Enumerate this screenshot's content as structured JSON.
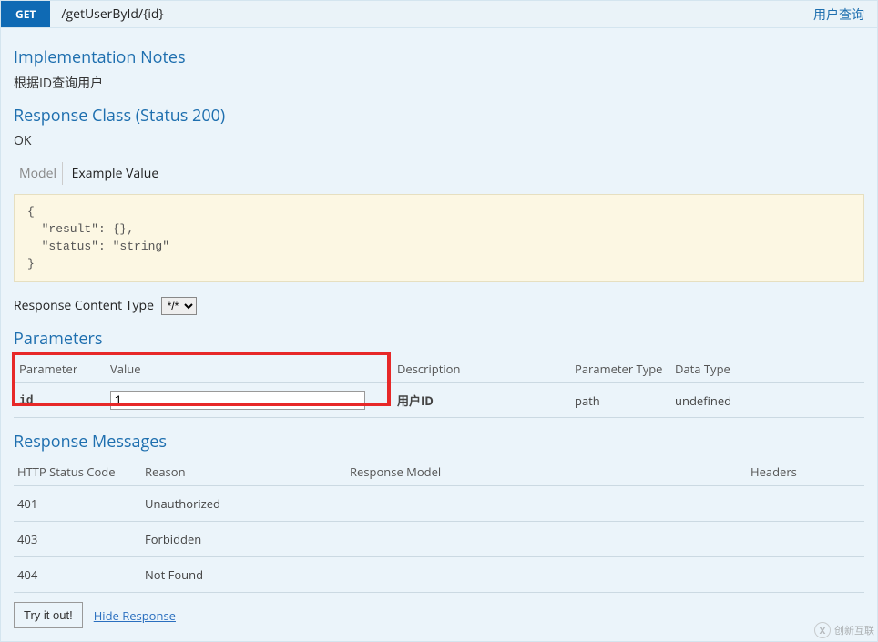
{
  "header": {
    "method": "GET",
    "path": "/getUserById/{id}",
    "summary": "用户查询"
  },
  "notes": {
    "heading": "Implementation Notes",
    "text": "根据ID查询用户"
  },
  "response_class": {
    "heading": "Response Class (Status 200)",
    "status_text": "OK",
    "tabs": {
      "model": "Model",
      "example": "Example Value"
    },
    "example_json": "{\n  \"result\": {},\n  \"status\": \"string\"\n}"
  },
  "content_type": {
    "label": "Response Content Type",
    "selected": "*/*"
  },
  "parameters": {
    "heading": "Parameters",
    "columns": {
      "parameter": "Parameter",
      "value": "Value",
      "description": "Description",
      "ptype": "Parameter Type",
      "dtype": "Data Type"
    },
    "rows": [
      {
        "name": "id",
        "value": "1",
        "description": "用户ID",
        "ptype": "path",
        "dtype": "undefined"
      }
    ]
  },
  "response_messages": {
    "heading": "Response Messages",
    "columns": {
      "code": "HTTP Status Code",
      "reason": "Reason",
      "model": "Response Model",
      "headers": "Headers"
    },
    "rows": [
      {
        "code": "401",
        "reason": "Unauthorized",
        "model": "",
        "headers": ""
      },
      {
        "code": "403",
        "reason": "Forbidden",
        "model": "",
        "headers": ""
      },
      {
        "code": "404",
        "reason": "Not Found",
        "model": "",
        "headers": ""
      }
    ]
  },
  "actions": {
    "try": "Try it out!",
    "hide": "Hide Response"
  },
  "watermark": {
    "text": "创新互联"
  }
}
